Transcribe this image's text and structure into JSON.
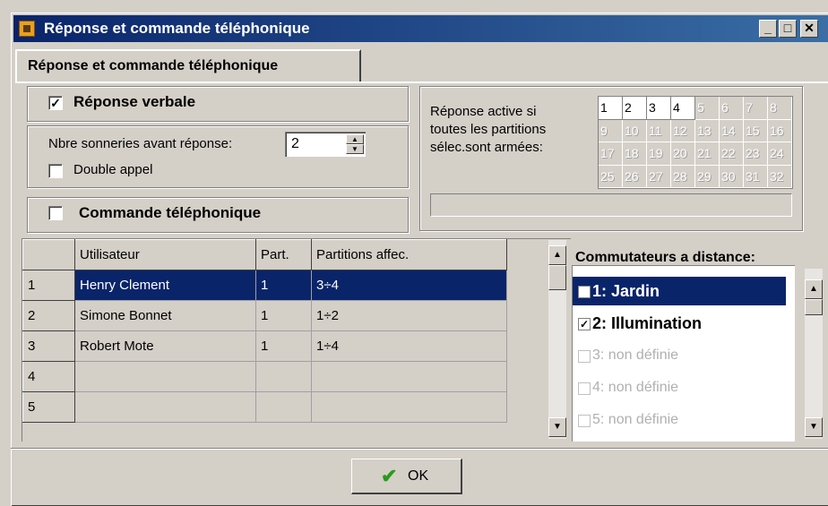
{
  "window": {
    "title": "Réponse et commande téléphonique",
    "min_icon": "minimize-icon",
    "max_icon": "maximize-icon",
    "close_icon": "close-icon",
    "min_glyph": "_",
    "max_glyph": "□",
    "close_glyph": "✕"
  },
  "tab": {
    "label": "Réponse et commande téléphonique"
  },
  "voice": {
    "label": "Réponse verbale",
    "checked": true,
    "check_glyph": "✓"
  },
  "rings": {
    "label": "Nbre sonneries avant réponse:",
    "value": "2",
    "up": "▲",
    "down": "▼"
  },
  "double_call": {
    "label": "Double appel",
    "checked": false
  },
  "phone_cmd": {
    "label": "Commande téléphonique",
    "checked": false
  },
  "partitions": {
    "label1": "Réponse active si",
    "label2": "toutes les partitions",
    "label3": "sélec.sont armées:",
    "cells": [
      "1",
      "2",
      "3",
      "4",
      "5",
      "6",
      "7",
      "8",
      "9",
      "10",
      "11",
      "12",
      "13",
      "14",
      "15",
      "16",
      "17",
      "18",
      "19",
      "20",
      "21",
      "22",
      "23",
      "24",
      "25",
      "26",
      "27",
      "28",
      "29",
      "30",
      "31",
      "32"
    ],
    "active": [
      "1",
      "2",
      "3",
      "4"
    ]
  },
  "users": {
    "headers": [
      "",
      "Utilisateur",
      "Part.",
      "Partitions affec."
    ],
    "rows": [
      [
        "1",
        "Henry Clement",
        "1",
        "3÷4"
      ],
      [
        "2",
        "Simone Bonnet",
        "1",
        "1÷2"
      ],
      [
        "3",
        "Robert Mote",
        "1",
        "1÷4"
      ],
      [
        "4",
        "",
        "",
        ""
      ],
      [
        "5",
        "",
        "",
        ""
      ]
    ],
    "selected_row": 0
  },
  "switches": {
    "title": "Commutateurs a distance:",
    "items": [
      {
        "label": "1: Jardin",
        "checked": true,
        "enabled": true
      },
      {
        "label": "2: Illumination",
        "checked": true,
        "enabled": true
      },
      {
        "label": "3: non définie",
        "checked": false,
        "enabled": false
      },
      {
        "label": "4: non définie",
        "checked": false,
        "enabled": false
      },
      {
        "label": "5: non définie",
        "checked": false,
        "enabled": false
      }
    ]
  },
  "scroll": {
    "up": "▲",
    "down": "▼"
  },
  "ok_button": {
    "label": "OK",
    "icon": "checkmark-icon",
    "glyph": "✔"
  }
}
